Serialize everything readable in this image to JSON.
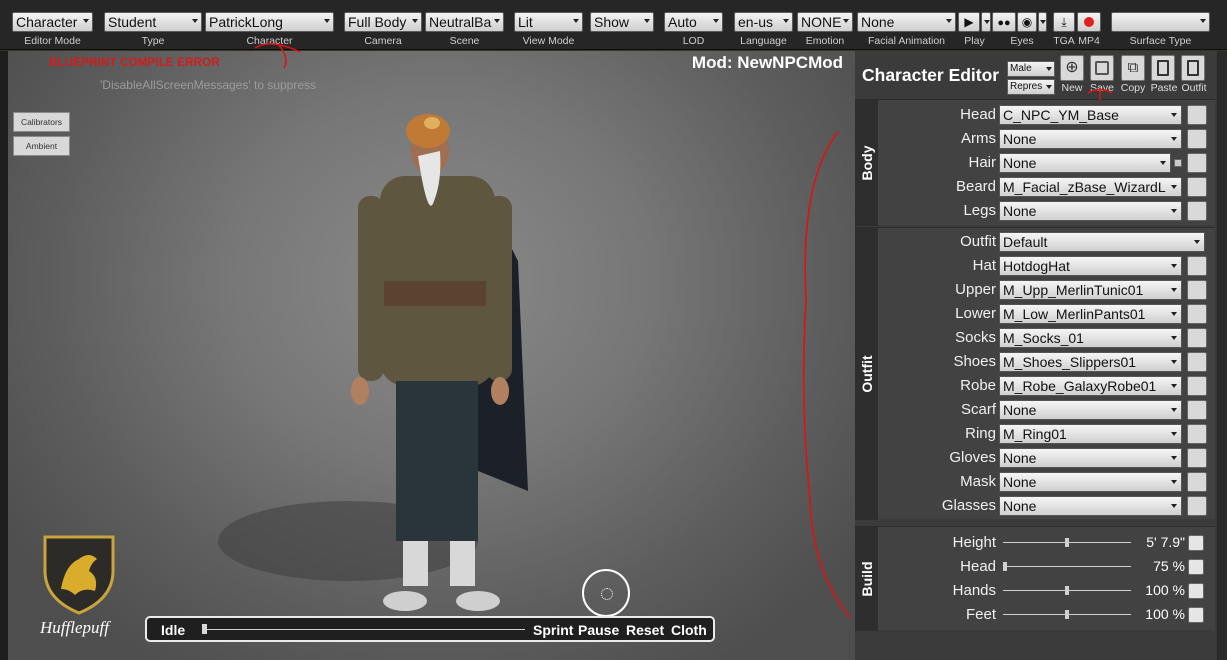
{
  "toolbar": {
    "editor_mode": {
      "value": "Character",
      "label": "Editor Mode"
    },
    "type": {
      "value": "Student",
      "label": "Type"
    },
    "character": {
      "value": "PatrickLong",
      "label": "Character"
    },
    "camera": {
      "value": "Full Body",
      "label": "Camera"
    },
    "scene": {
      "value": "NeutralBa",
      "label": "Scene"
    },
    "view_mode": {
      "value": "Lit",
      "label": "View Mode"
    },
    "show": {
      "value": "Show"
    },
    "lod": {
      "value": "Auto",
      "label": "LOD"
    },
    "language": {
      "value": "en-us",
      "label": "Language"
    },
    "emotion": {
      "value": "NONE",
      "label": "Emotion"
    },
    "facial_animation": {
      "value": "None",
      "label": "Facial Animation"
    },
    "play_label": "Play",
    "eyes_label": "Eyes",
    "tga_label": "TGA",
    "mp4_label": "MP4",
    "surface_type": {
      "value": "",
      "label": "Surface Type"
    }
  },
  "viewport": {
    "error_text": "BLUEPRINT COMPILE ERROR",
    "suppress_text": "'DisableAllScreenMessages' to suppress",
    "mod_text": "Mod: NewNPCMod",
    "side_buttons": [
      "Calibrators",
      "Ambient"
    ],
    "house": "Hufflepuff",
    "anim": {
      "idle": "Idle",
      "sprint": "Sprint",
      "pause": "Pause",
      "reset": "Reset",
      "cloth": "Cloth",
      "progress": 0.0
    }
  },
  "panel": {
    "title": "Character Editor",
    "gender": "Male",
    "repres": "Repres",
    "actions": [
      "New",
      "Save",
      "Copy",
      "Paste",
      "Outfit"
    ],
    "body_label": "Body",
    "body": [
      {
        "label": "Head",
        "value": "C_NPC_YM_Base"
      },
      {
        "label": "Arms",
        "value": "None"
      },
      {
        "label": "Hair",
        "value": "None"
      },
      {
        "label": "Beard",
        "value": "M_Facial_zBase_WizardL"
      },
      {
        "label": "Legs",
        "value": "None"
      }
    ],
    "outfit_label": "Outfit",
    "outfit": [
      {
        "label": "Outfit",
        "value": "Default"
      },
      {
        "label": "Hat",
        "value": "HotdogHat"
      },
      {
        "label": "Upper",
        "value": "M_Upp_MerlinTunic01"
      },
      {
        "label": "Lower",
        "value": "M_Low_MerlinPants01"
      },
      {
        "label": "Socks",
        "value": "M_Socks_01"
      },
      {
        "label": "Shoes",
        "value": "M_Shoes_Slippers01"
      },
      {
        "label": "Robe",
        "value": "M_Robe_GalaxyRobe01"
      },
      {
        "label": "Scarf",
        "value": "None"
      },
      {
        "label": "Ring",
        "value": "M_Ring01"
      },
      {
        "label": "Gloves",
        "value": "None"
      },
      {
        "label": "Mask",
        "value": "None"
      },
      {
        "label": "Glasses",
        "value": "None"
      }
    ],
    "build_label": "Build",
    "build": [
      {
        "label": "Height",
        "value": "5' 7.9\"",
        "level": 0.5
      },
      {
        "label": "Head",
        "value": "75 %",
        "level": 0.0
      },
      {
        "label": "Hands",
        "value": "100 %",
        "level": 0.5
      },
      {
        "label": "Feet",
        "value": "100 %",
        "level": 0.5
      }
    ]
  },
  "colors": {
    "error": "#d41b1b",
    "annotation": "#e0120f"
  }
}
